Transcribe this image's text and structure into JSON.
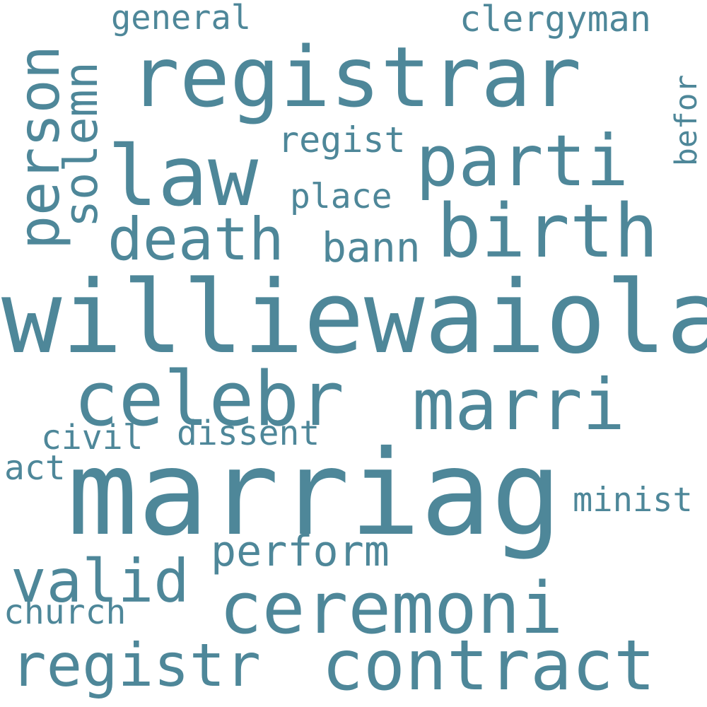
{
  "word_cloud": {
    "color": "#4e8799",
    "background": "#ffffff",
    "words": {
      "marriag": "marriag",
      "williewaiola": "williewaiola",
      "registrar": "registrar",
      "law": "law",
      "celebr": "celebr",
      "birth": "birth",
      "ceremoni": "ceremoni",
      "marri": "marri",
      "parti": "parti",
      "contract": "contract",
      "valid": "valid",
      "registr": "registr",
      "death": "death",
      "person": "person",
      "solemn": "solemn",
      "perform": "perform",
      "bann": "bann",
      "regist": "regist",
      "clergyman": "clergyman",
      "place": "place",
      "general": "general",
      "dissent": "dissent",
      "civil": "civil",
      "act": "act",
      "minist": "minist",
      "church": "church",
      "befor": "befor"
    }
  }
}
